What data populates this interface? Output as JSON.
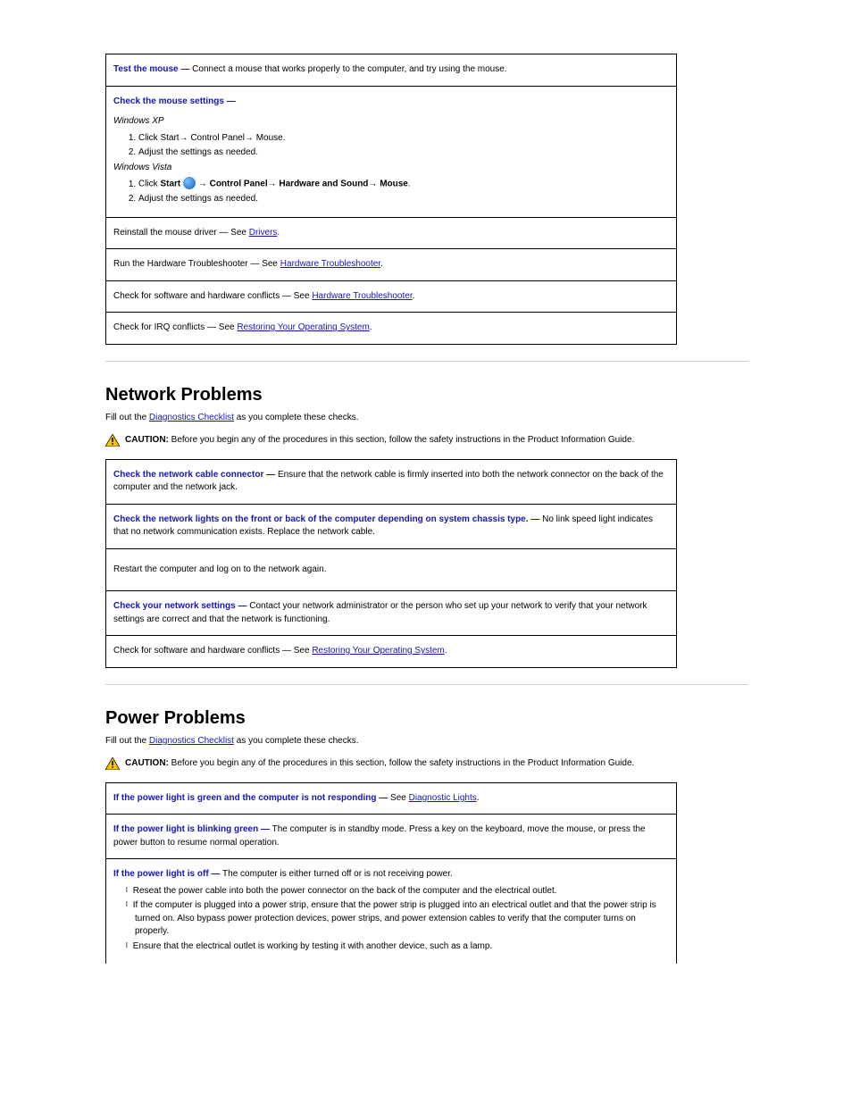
{
  "mouse": {
    "rows": [
      {
        "label": "Test the mouse —",
        "body": " Connect a mouse that works properly to the computer, and try using the mouse."
      },
      {
        "label": "Check the mouse settings —",
        "xp_label": "Windows XP",
        "xp_steps": [
          "Click Start→ Control Panel→ Mouse.",
          "Adjust the settings as needed."
        ],
        "vista_label": "Windows Vista",
        "vista_steps": [
          "Click Start   → Control Panel→ Hardware and Sound→ Mouse.",
          "Adjust the settings as needed."
        ]
      },
      {
        "plain_prefix": "Reinstall the mouse driver — See ",
        "link": "Drivers",
        "plain_suffix": "."
      },
      {
        "plain_prefix": "Run the Hardware Troubleshooter — See ",
        "link": "Hardware Troubleshooter",
        "plain_suffix": "."
      },
      {
        "plain_prefix": "Check for software and hardware conflicts — See ",
        "link": "Hardware Troubleshooter",
        "plain_suffix": "."
      },
      {
        "plain_prefix": "Check for IRQ conflicts — See ",
        "link": "Restoring Your Operating System",
        "plain_suffix": "."
      }
    ]
  },
  "network": {
    "title": "Network Problems",
    "intro_before": "Fill out the ",
    "intro_link": "Diagnostics Checklist",
    "intro_after": " as you complete these checks.",
    "caution_label": "CAUTION: ",
    "caution_text": "Before you begin any of the procedures in this section, follow the safety instructions in the Product Information Guide.",
    "rows": [
      {
        "label": "Check the network cable connector —",
        "body": " Ensure that the network cable is firmly inserted into both the network connector on the back of the computer and the network jack."
      },
      {
        "label": "Check the network lights on the front or back of the computer depending on system chassis type. —",
        "body": " No link speed light indicates that no network communication exists. Replace the network cable."
      },
      {
        "plain": "Restart the computer and log on to the network again."
      },
      {
        "label": "Check your network settings —",
        "body": " Contact your network administrator or the person who set up your network to verify that your network settings are correct and that the network is functioning."
      },
      {
        "plain_prefix": "Check for software and hardware conflicts — See ",
        "link": "Restoring Your Operating System",
        "plain_suffix": "."
      }
    ]
  },
  "power": {
    "title": "Power Problems",
    "intro_before": "Fill out the ",
    "intro_link": "Diagnostics Checklist",
    "intro_after": " as you complete these checks.",
    "caution_label": "CAUTION: ",
    "caution_text": "Before you begin any of the procedures in this section, follow the safety instructions in the Product Information Guide.",
    "rows": [
      {
        "label": "If the power light is green and the computer is not responding —",
        "body_before": " See ",
        "link": "Diagnostic Lights",
        "body_after": "."
      },
      {
        "label": "If the power light is blinking green —",
        "body": " The computer is in standby mode. Press a key on the keyboard, move the mouse, or press the power button to resume normal operation."
      },
      {
        "label": "If the power light is off —",
        "body": " The computer is either turned off or is not receiving power.",
        "bullets": [
          "Reseat the power cable into both the power connector on the back of the computer and the electrical outlet.",
          "If the computer is plugged into a power strip, ensure that the power strip is plugged into an electrical outlet and that the power strip is turned on. Also bypass power protection devices, power strips, and power extension cables to verify that the computer turns on properly.",
          "Ensure that the electrical outlet is working by testing it with another device, such as a lamp."
        ]
      }
    ]
  }
}
